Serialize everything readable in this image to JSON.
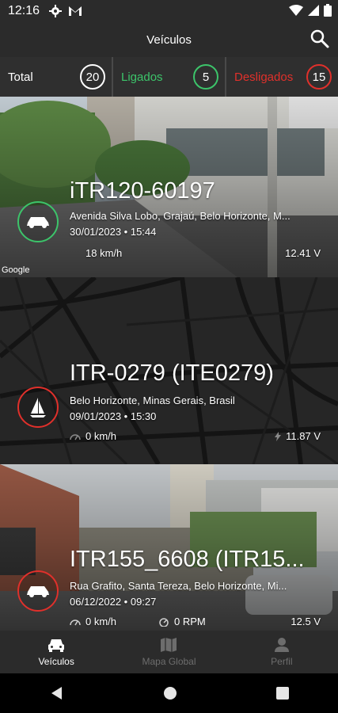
{
  "status_bar": {
    "time": "12:16",
    "icons": [
      "settings-icon",
      "gmail-icon",
      "wifi-icon",
      "signal-icon",
      "battery-icon"
    ]
  },
  "app_bar": {
    "title": "Veículos",
    "search_icon": "search-icon"
  },
  "counters": [
    {
      "label": "Total",
      "count": "20",
      "color": "#ffffff"
    },
    {
      "label": "Ligados",
      "count": "5",
      "color": "#3cc46a"
    },
    {
      "label": "Desligados",
      "count": "15",
      "color": "#e0302b"
    }
  ],
  "vehicles": [
    {
      "title": "iTR120-60197",
      "address": "Avenida Silva Lobo, Grajaú, Belo Horizonte, M...",
      "datetime": "30/01/2023 • 15:44",
      "speed": "18 km/h",
      "voltage": "12.41 V",
      "status": "on",
      "status_color": "#3cc46a",
      "icon": "car-icon",
      "image_watermark": "Google",
      "background": "street-view"
    },
    {
      "title": "ITR-0279 (ITE0279)",
      "address": "Belo Horizonte, Minas Gerais, Brasil",
      "datetime": "09/01/2023 • 15:30",
      "speed": "0 km/h",
      "voltage": "11.87 V",
      "status": "off",
      "status_color": "#e0302b",
      "icon": "sailboat-icon",
      "background": "map"
    },
    {
      "title": "ITR155_6608 (ITR15...",
      "address": "Rua Grafito, Santa Tereza, Belo Horizonte, Mi...",
      "datetime": "06/12/2022 • 09:27",
      "speed": "0 km/h",
      "rpm": "0 RPM",
      "voltage": "12.5 V",
      "status": "off",
      "status_color": "#e0302b",
      "icon": "car-icon",
      "background": "street-view"
    }
  ],
  "bottom_nav": [
    {
      "label": "Veículos",
      "icon": "car-icon",
      "active": true
    },
    {
      "label": "Mapa Global",
      "icon": "map-icon",
      "active": false
    },
    {
      "label": "Perfil",
      "icon": "person-icon",
      "active": false
    }
  ],
  "system_nav": [
    "back-icon",
    "home-icon",
    "recents-icon"
  ]
}
